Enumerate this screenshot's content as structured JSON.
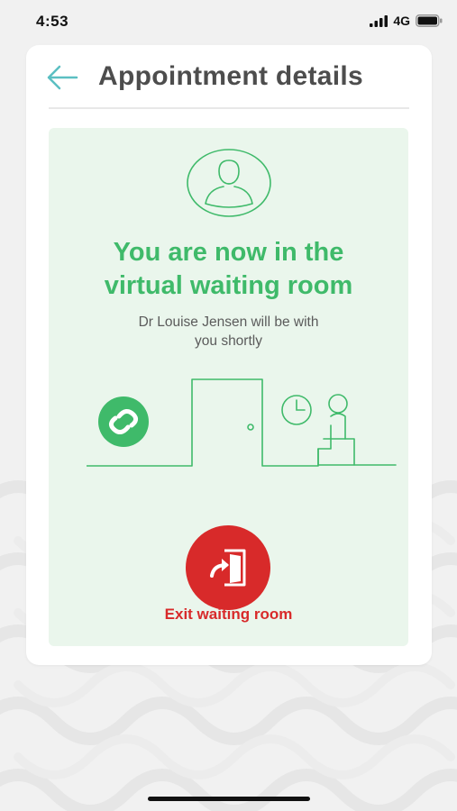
{
  "status_bar": {
    "time": "4:53",
    "network": "4G",
    "icons": [
      "signal-bars-icon",
      "battery-icon"
    ]
  },
  "header": {
    "title": "Appointment details",
    "back_icon": "arrow-left-icon"
  },
  "waiting_room": {
    "headline_line1": "You are now in the",
    "headline_line2": "virtual waiting room",
    "subtext_line1": "Dr Louise Jensen will be with",
    "subtext_line2": "you shortly",
    "illustration_icons": [
      "app-logo-icon",
      "door-icon",
      "clock-icon",
      "seated-person-icon"
    ]
  },
  "exit": {
    "label": "Exit waiting room",
    "icon": "exit-door-icon"
  },
  "colors": {
    "accent_green": "#3fba6a",
    "panel_background": "#eaf6ec",
    "exit_red": "#d82a2a",
    "title_gray": "#4d4d4d",
    "back_arrow_teal": "#5bbfc2"
  }
}
